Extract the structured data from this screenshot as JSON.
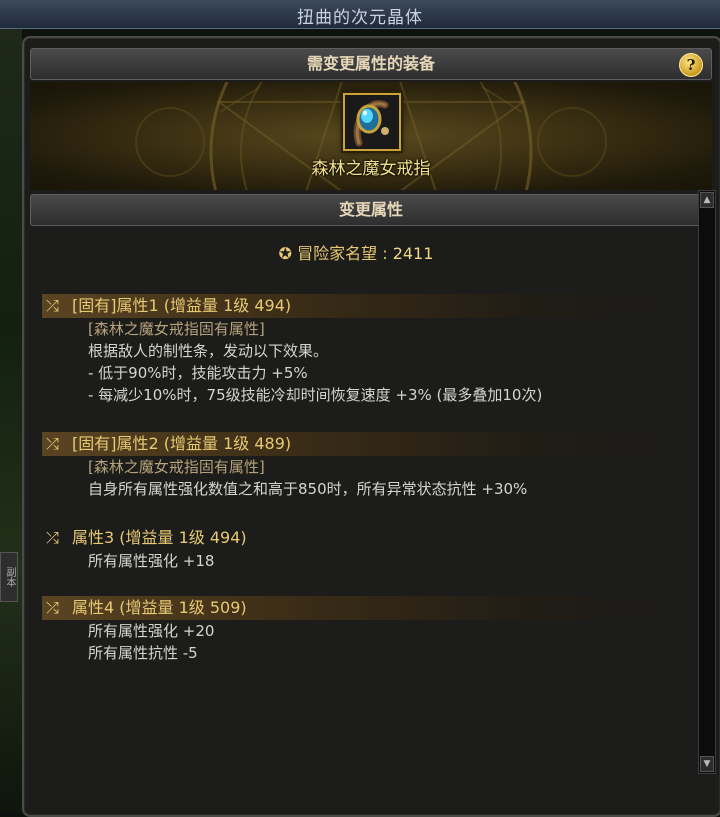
{
  "window": {
    "title": "扭曲的次元晶体"
  },
  "header": {
    "equip_title": "需变更属性的装备",
    "help_label": "?"
  },
  "item": {
    "name": "森林之魔女戒指",
    "icon": "witch-ring-icon"
  },
  "change_section": {
    "title": "变更属性"
  },
  "fame": {
    "label": "冒险家名望",
    "separator": ":",
    "value": "2411"
  },
  "attributes": [
    {
      "head": "[固有]属性1 (增益量 1级 494)",
      "lines": [
        "[森林之魔女戒指固有属性]",
        "根据敌人的制性条，发动以下效果。",
        "- 低于90%时，技能攻击力 +5%",
        "- 每减少10%时，75级技能冷却时间恢复速度 +3% (最多叠加10次)"
      ]
    },
    {
      "head": "[固有]属性2 (增益量 1级 489)",
      "lines": [
        "[森林之魔女戒指固有属性]",
        "自身所有属性强化数值之和高于850时，所有异常状态抗性 +30%"
      ]
    },
    {
      "head": "属性3 (增益量 1级 494)",
      "lines": [
        "所有属性强化 +18"
      ]
    },
    {
      "head": "属性4 (增益量 1级 509)",
      "lines": [
        "所有属性强化 +20",
        "所有属性抗性 -5"
      ]
    }
  ],
  "side_tab": {
    "label": "副本"
  },
  "colors": {
    "gold": "#e8c973",
    "text": "#d4d4d0",
    "accent_frame": "#c9a23a"
  }
}
